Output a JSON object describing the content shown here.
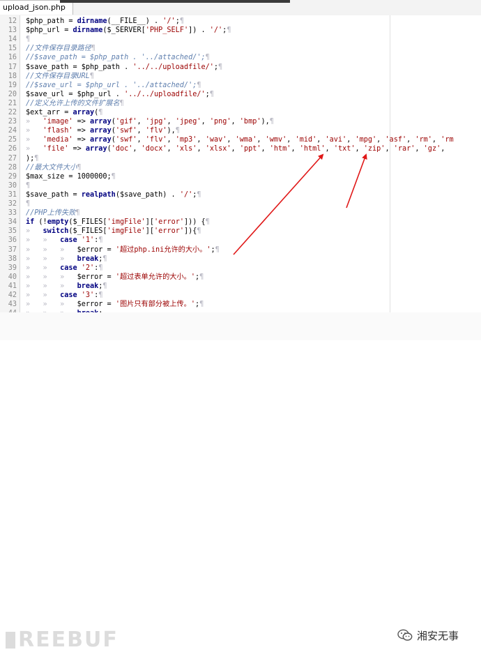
{
  "tab": {
    "title": "upload_json.php"
  },
  "lines": [
    {
      "n": "12",
      "tokens": [
        {
          "t": "$php_path = ",
          "c": "default"
        },
        {
          "t": "dirname",
          "c": "func"
        },
        {
          "t": "(__FILE__) . ",
          "c": "default"
        },
        {
          "t": "'/'",
          "c": "string"
        },
        {
          "t": ";",
          "c": "default"
        },
        {
          "t": "¶",
          "c": "pilcrow"
        }
      ]
    },
    {
      "n": "13",
      "tokens": [
        {
          "t": "$php_url = ",
          "c": "default"
        },
        {
          "t": "dirname",
          "c": "func"
        },
        {
          "t": "($_SERVER[",
          "c": "default"
        },
        {
          "t": "'PHP_SELF'",
          "c": "string"
        },
        {
          "t": "]) . ",
          "c": "default"
        },
        {
          "t": "'/'",
          "c": "string"
        },
        {
          "t": ";",
          "c": "default"
        },
        {
          "t": "¶",
          "c": "pilcrow"
        }
      ]
    },
    {
      "n": "14",
      "tokens": [
        {
          "t": "¶",
          "c": "pilcrow"
        }
      ]
    },
    {
      "n": "15",
      "tokens": [
        {
          "t": "//文件保存目录路径",
          "c": "comment"
        },
        {
          "t": "¶",
          "c": "pilcrow"
        }
      ]
    },
    {
      "n": "16",
      "tokens": [
        {
          "t": "//$save_path = $php_path . '../attached/';",
          "c": "comment"
        },
        {
          "t": "¶",
          "c": "pilcrow"
        }
      ]
    },
    {
      "n": "17",
      "tokens": [
        {
          "t": "$save_path = $php_path . ",
          "c": "default"
        },
        {
          "t": "'../../uploadfile/'",
          "c": "string"
        },
        {
          "t": ";",
          "c": "default"
        },
        {
          "t": "¶",
          "c": "pilcrow"
        }
      ]
    },
    {
      "n": "18",
      "tokens": [
        {
          "t": "//文件保存目录URL",
          "c": "comment"
        },
        {
          "t": "¶",
          "c": "pilcrow"
        }
      ]
    },
    {
      "n": "19",
      "tokens": [
        {
          "t": "//$save_url = $php_url . '../attached/';",
          "c": "comment"
        },
        {
          "t": "¶",
          "c": "pilcrow"
        }
      ]
    },
    {
      "n": "20",
      "tokens": [
        {
          "t": "$save_url = $php_url . ",
          "c": "default"
        },
        {
          "t": "'../../uploadfile/'",
          "c": "string"
        },
        {
          "t": ";",
          "c": "default"
        },
        {
          "t": "¶",
          "c": "pilcrow"
        }
      ]
    },
    {
      "n": "21",
      "tokens": [
        {
          "t": "//定义允许上传的文件扩展名",
          "c": "comment"
        },
        {
          "t": "¶",
          "c": "pilcrow"
        }
      ]
    },
    {
      "n": "22",
      "tokens": [
        {
          "t": "$ext_arr = ",
          "c": "default"
        },
        {
          "t": "array",
          "c": "func"
        },
        {
          "t": "(",
          "c": "default"
        },
        {
          "t": "¶",
          "c": "pilcrow"
        }
      ]
    },
    {
      "n": "23",
      "tokens": [
        {
          "t": "»   ",
          "c": "guide"
        },
        {
          "t": "'image'",
          "c": "string"
        },
        {
          "t": " => ",
          "c": "default"
        },
        {
          "t": "array",
          "c": "func"
        },
        {
          "t": "(",
          "c": "default"
        },
        {
          "t": "'gif'",
          "c": "string"
        },
        {
          "t": ", ",
          "c": "default"
        },
        {
          "t": "'jpg'",
          "c": "string"
        },
        {
          "t": ", ",
          "c": "default"
        },
        {
          "t": "'jpeg'",
          "c": "string"
        },
        {
          "t": ", ",
          "c": "default"
        },
        {
          "t": "'png'",
          "c": "string"
        },
        {
          "t": ", ",
          "c": "default"
        },
        {
          "t": "'bmp'",
          "c": "string"
        },
        {
          "t": "),",
          "c": "default"
        },
        {
          "t": "¶",
          "c": "pilcrow"
        }
      ]
    },
    {
      "n": "24",
      "tokens": [
        {
          "t": "»   ",
          "c": "guide"
        },
        {
          "t": "'flash'",
          "c": "string"
        },
        {
          "t": " => ",
          "c": "default"
        },
        {
          "t": "array",
          "c": "func"
        },
        {
          "t": "(",
          "c": "default"
        },
        {
          "t": "'swf'",
          "c": "string"
        },
        {
          "t": ", ",
          "c": "default"
        },
        {
          "t": "'flv'",
          "c": "string"
        },
        {
          "t": "),",
          "c": "default"
        },
        {
          "t": "¶",
          "c": "pilcrow"
        }
      ]
    },
    {
      "n": "25",
      "tokens": [
        {
          "t": "»   ",
          "c": "guide"
        },
        {
          "t": "'media'",
          "c": "string"
        },
        {
          "t": " => ",
          "c": "default"
        },
        {
          "t": "array",
          "c": "func"
        },
        {
          "t": "(",
          "c": "default"
        },
        {
          "t": "'swf'",
          "c": "string"
        },
        {
          "t": ", ",
          "c": "default"
        },
        {
          "t": "'flv'",
          "c": "string"
        },
        {
          "t": ", ",
          "c": "default"
        },
        {
          "t": "'mp3'",
          "c": "string"
        },
        {
          "t": ", ",
          "c": "default"
        },
        {
          "t": "'wav'",
          "c": "string"
        },
        {
          "t": ", ",
          "c": "default"
        },
        {
          "t": "'wma'",
          "c": "string"
        },
        {
          "t": ", ",
          "c": "default"
        },
        {
          "t": "'wmv'",
          "c": "string"
        },
        {
          "t": ", ",
          "c": "default"
        },
        {
          "t": "'mid'",
          "c": "string"
        },
        {
          "t": ", ",
          "c": "default"
        },
        {
          "t": "'avi'",
          "c": "string"
        },
        {
          "t": ", ",
          "c": "default"
        },
        {
          "t": "'mpg'",
          "c": "string"
        },
        {
          "t": ", ",
          "c": "default"
        },
        {
          "t": "'asf'",
          "c": "string"
        },
        {
          "t": ", ",
          "c": "default"
        },
        {
          "t": "'rm'",
          "c": "string"
        },
        {
          "t": ", ",
          "c": "default"
        },
        {
          "t": "'rm",
          "c": "string"
        }
      ]
    },
    {
      "n": "26",
      "tokens": [
        {
          "t": "»   ",
          "c": "guide"
        },
        {
          "t": "'file'",
          "c": "string"
        },
        {
          "t": " => ",
          "c": "default"
        },
        {
          "t": "array",
          "c": "func"
        },
        {
          "t": "(",
          "c": "default"
        },
        {
          "t": "'doc'",
          "c": "string"
        },
        {
          "t": ", ",
          "c": "default"
        },
        {
          "t": "'docx'",
          "c": "string"
        },
        {
          "t": ", ",
          "c": "default"
        },
        {
          "t": "'xls'",
          "c": "string"
        },
        {
          "t": ", ",
          "c": "default"
        },
        {
          "t": "'xlsx'",
          "c": "string"
        },
        {
          "t": ", ",
          "c": "default"
        },
        {
          "t": "'ppt'",
          "c": "string"
        },
        {
          "t": ", ",
          "c": "default"
        },
        {
          "t": "'htm'",
          "c": "string"
        },
        {
          "t": ", ",
          "c": "default"
        },
        {
          "t": "'html'",
          "c": "string"
        },
        {
          "t": ", ",
          "c": "default"
        },
        {
          "t": "'txt'",
          "c": "string"
        },
        {
          "t": ", ",
          "c": "default"
        },
        {
          "t": "'zip'",
          "c": "string"
        },
        {
          "t": ", ",
          "c": "default"
        },
        {
          "t": "'rar'",
          "c": "string"
        },
        {
          "t": ", ",
          "c": "default"
        },
        {
          "t": "'gz'",
          "c": "string"
        },
        {
          "t": ",",
          "c": "default"
        }
      ]
    },
    {
      "n": "27",
      "tokens": [
        {
          "t": ");",
          "c": "default"
        },
        {
          "t": "¶",
          "c": "pilcrow"
        }
      ]
    },
    {
      "n": "28",
      "tokens": [
        {
          "t": "//最大文件大小",
          "c": "comment"
        },
        {
          "t": "¶",
          "c": "pilcrow"
        }
      ]
    },
    {
      "n": "29",
      "tokens": [
        {
          "t": "$max_size = 1000000;",
          "c": "default"
        },
        {
          "t": "¶",
          "c": "pilcrow"
        }
      ]
    },
    {
      "n": "30",
      "tokens": [
        {
          "t": "¶",
          "c": "pilcrow"
        }
      ]
    },
    {
      "n": "31",
      "tokens": [
        {
          "t": "$save_path = ",
          "c": "default"
        },
        {
          "t": "realpath",
          "c": "func"
        },
        {
          "t": "($save_path) . ",
          "c": "default"
        },
        {
          "t": "'/'",
          "c": "string"
        },
        {
          "t": ";",
          "c": "default"
        },
        {
          "t": "¶",
          "c": "pilcrow"
        }
      ]
    },
    {
      "n": "32",
      "tokens": [
        {
          "t": "¶",
          "c": "pilcrow"
        }
      ]
    },
    {
      "n": "33",
      "tokens": [
        {
          "t": "//PHP上传失败",
          "c": "comment"
        },
        {
          "t": "¶",
          "c": "pilcrow"
        }
      ]
    },
    {
      "n": "34",
      "tokens": [
        {
          "t": "if",
          "c": "func"
        },
        {
          "t": " (!",
          "c": "default"
        },
        {
          "t": "empty",
          "c": "func"
        },
        {
          "t": "($_FILES[",
          "c": "default"
        },
        {
          "t": "'imgFile'",
          "c": "string"
        },
        {
          "t": "][",
          "c": "default"
        },
        {
          "t": "'error'",
          "c": "string"
        },
        {
          "t": "])) {",
          "c": "default"
        },
        {
          "t": "¶",
          "c": "pilcrow"
        }
      ]
    },
    {
      "n": "35",
      "tokens": [
        {
          "t": "»   ",
          "c": "guide"
        },
        {
          "t": "switch",
          "c": "func"
        },
        {
          "t": "($_FILES[",
          "c": "default"
        },
        {
          "t": "'imgFile'",
          "c": "string"
        },
        {
          "t": "][",
          "c": "default"
        },
        {
          "t": "'error'",
          "c": "string"
        },
        {
          "t": "]){",
          "c": "default"
        },
        {
          "t": "¶",
          "c": "pilcrow"
        }
      ]
    },
    {
      "n": "36",
      "tokens": [
        {
          "t": "»   »   ",
          "c": "guide"
        },
        {
          "t": "case",
          "c": "func"
        },
        {
          "t": " ",
          "c": "default"
        },
        {
          "t": "'1'",
          "c": "string"
        },
        {
          "t": ":",
          "c": "default"
        },
        {
          "t": "¶",
          "c": "pilcrow"
        }
      ]
    },
    {
      "n": "37",
      "tokens": [
        {
          "t": "»   »   »   ",
          "c": "guide"
        },
        {
          "t": "$error = ",
          "c": "default"
        },
        {
          "t": "'超过php.ini允许的大小。'",
          "c": "string"
        },
        {
          "t": ";",
          "c": "default"
        },
        {
          "t": "¶",
          "c": "pilcrow"
        }
      ]
    },
    {
      "n": "38",
      "tokens": [
        {
          "t": "»   »   »   ",
          "c": "guide"
        },
        {
          "t": "break",
          "c": "func"
        },
        {
          "t": ";",
          "c": "default"
        },
        {
          "t": "¶",
          "c": "pilcrow"
        }
      ]
    },
    {
      "n": "39",
      "tokens": [
        {
          "t": "»   »   ",
          "c": "guide"
        },
        {
          "t": "case",
          "c": "func"
        },
        {
          "t": " ",
          "c": "default"
        },
        {
          "t": "'2'",
          "c": "string"
        },
        {
          "t": ":",
          "c": "default"
        },
        {
          "t": "¶",
          "c": "pilcrow"
        }
      ]
    },
    {
      "n": "40",
      "tokens": [
        {
          "t": "»   »   »   ",
          "c": "guide"
        },
        {
          "t": "$error = ",
          "c": "default"
        },
        {
          "t": "'超过表单允许的大小。'",
          "c": "string"
        },
        {
          "t": ";",
          "c": "default"
        },
        {
          "t": "¶",
          "c": "pilcrow"
        }
      ]
    },
    {
      "n": "41",
      "tokens": [
        {
          "t": "»   »   »   ",
          "c": "guide"
        },
        {
          "t": "break",
          "c": "func"
        },
        {
          "t": ";",
          "c": "default"
        },
        {
          "t": "¶",
          "c": "pilcrow"
        }
      ]
    },
    {
      "n": "42",
      "tokens": [
        {
          "t": "»   »   ",
          "c": "guide"
        },
        {
          "t": "case",
          "c": "func"
        },
        {
          "t": " ",
          "c": "default"
        },
        {
          "t": "'3'",
          "c": "string"
        },
        {
          "t": ":",
          "c": "default"
        },
        {
          "t": "¶",
          "c": "pilcrow"
        }
      ]
    },
    {
      "n": "43",
      "tokens": [
        {
          "t": "»   »   »   ",
          "c": "guide"
        },
        {
          "t": "$error = ",
          "c": "default"
        },
        {
          "t": "'图片只有部分被上传。'",
          "c": "string"
        },
        {
          "t": ";",
          "c": "default"
        },
        {
          "t": "¶",
          "c": "pilcrow"
        }
      ]
    },
    {
      "n": "44",
      "tokens": [
        {
          "t": "»   »   »   ",
          "c": "guide"
        },
        {
          "t": "break",
          "c": "func"
        },
        {
          "t": ";",
          "c": "default"
        }
      ]
    }
  ],
  "footer": {
    "watermark": "REEBUF",
    "brand": "湘安无事",
    "brand_icon": "wechat-icon"
  },
  "colors": {
    "func": "#000080",
    "string": "#9b0000",
    "comment": "#5f7fae",
    "annotation_arrow": "#e01818"
  }
}
